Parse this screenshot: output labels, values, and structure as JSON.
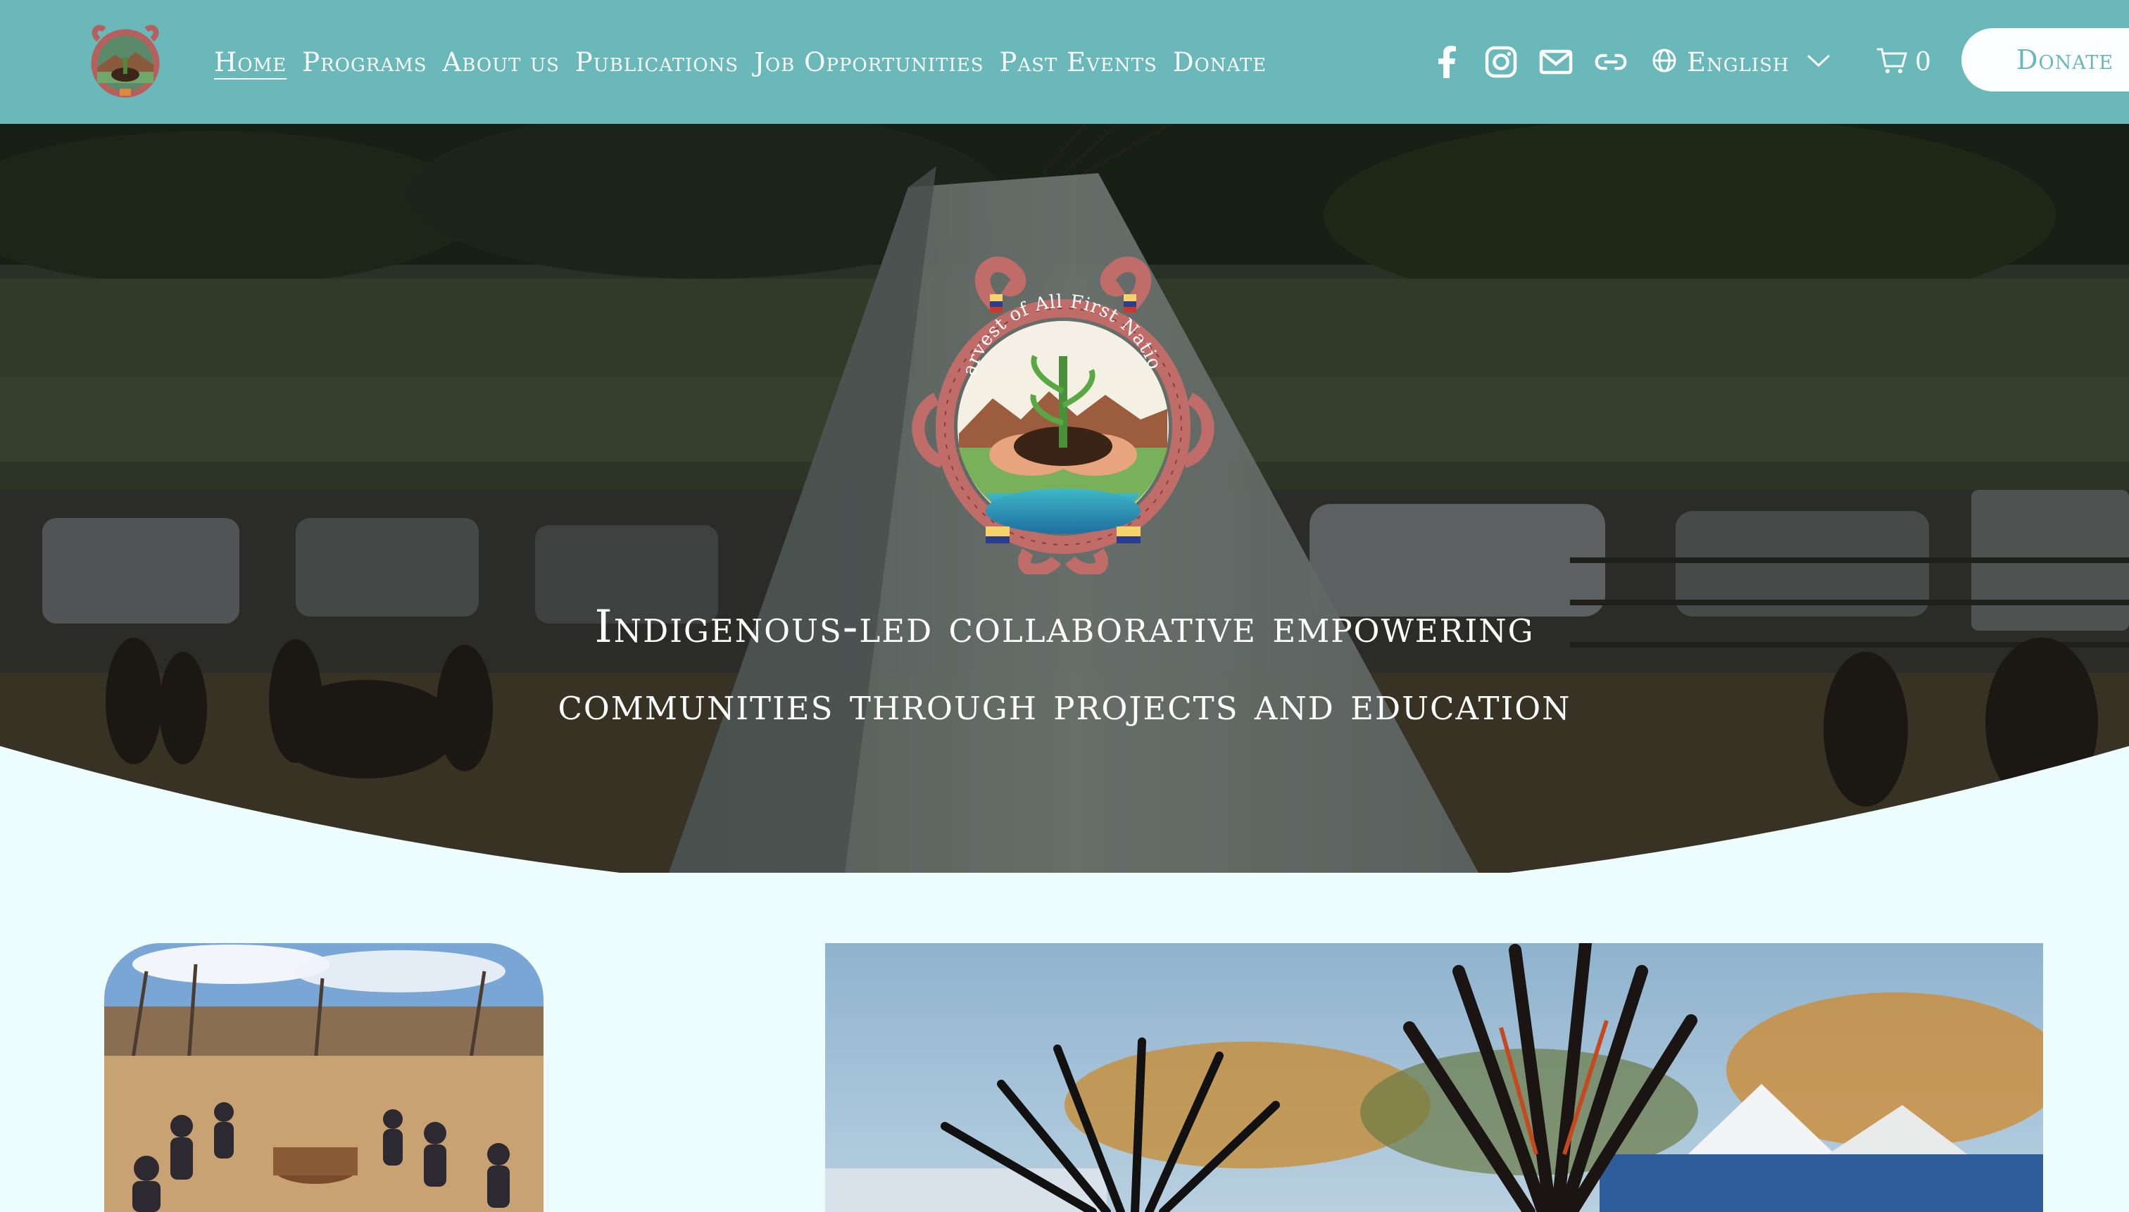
{
  "nav": {
    "items": [
      {
        "label": "Home",
        "active": true
      },
      {
        "label": "Programs"
      },
      {
        "label": "About us"
      },
      {
        "label": "Publications"
      },
      {
        "label": "Job Opportunities"
      },
      {
        "label": "Past Events"
      },
      {
        "label": "Donate"
      }
    ]
  },
  "social": {
    "icons": [
      "facebook-icon",
      "instagram-icon",
      "email-icon",
      "link-icon"
    ]
  },
  "language": {
    "label": "English"
  },
  "cart": {
    "count": "0"
  },
  "header": {
    "donate_label": "Donate"
  },
  "hero": {
    "seal_text": "Harvest of All First Nations",
    "title_line1": "Indigenous-led collaborative empowering",
    "title_line2": "communities through projects and education"
  },
  "colors": {
    "header_bg": "#6bb8ba",
    "page_bg": "#edfdfd",
    "nav_text": "#fbffff",
    "accent": "#6bb8ba"
  }
}
